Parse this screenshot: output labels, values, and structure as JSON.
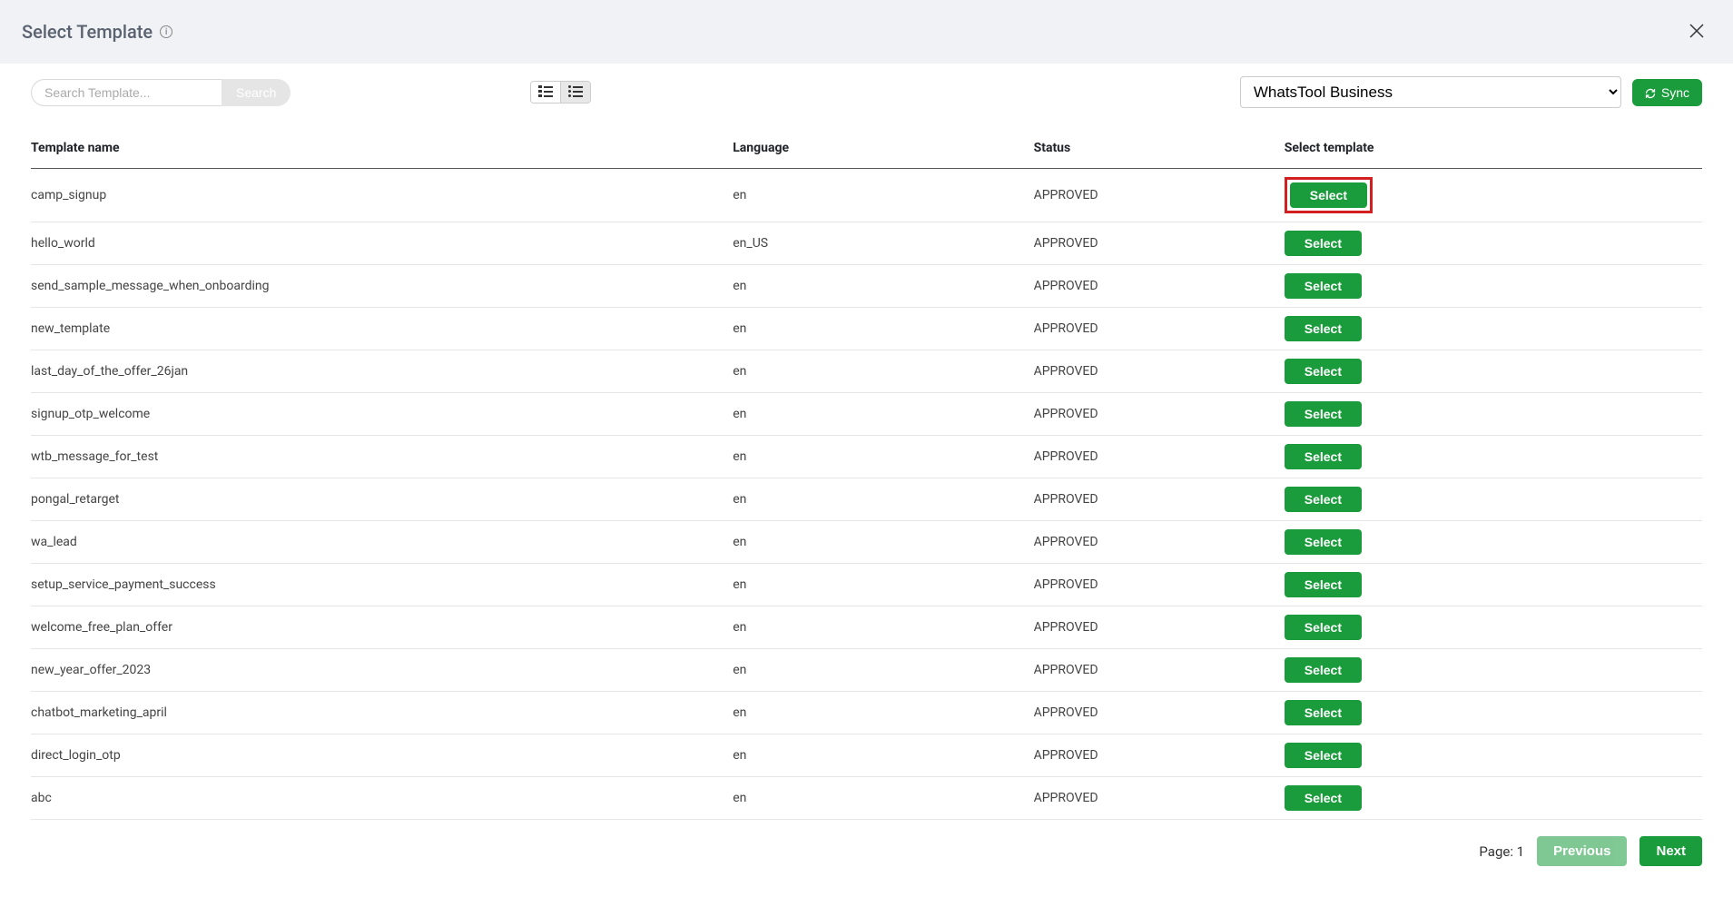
{
  "header": {
    "title": "Select Template"
  },
  "toolbar": {
    "search_placeholder": "Search Template...",
    "search_button": "Search",
    "account_selected": "WhatsTool Business",
    "sync_label": "Sync"
  },
  "table": {
    "columns": {
      "name": "Template name",
      "language": "Language",
      "status": "Status",
      "action": "Select template"
    },
    "select_label": "Select",
    "rows": [
      {
        "name": "camp_signup",
        "language": "en",
        "status": "APPROVED",
        "highlight": true
      },
      {
        "name": "hello_world",
        "language": "en_US",
        "status": "APPROVED",
        "highlight": false
      },
      {
        "name": "send_sample_message_when_onboarding",
        "language": "en",
        "status": "APPROVED",
        "highlight": false
      },
      {
        "name": "new_template",
        "language": "en",
        "status": "APPROVED",
        "highlight": false
      },
      {
        "name": "last_day_of_the_offer_26jan",
        "language": "en",
        "status": "APPROVED",
        "highlight": false
      },
      {
        "name": "signup_otp_welcome",
        "language": "en",
        "status": "APPROVED",
        "highlight": false
      },
      {
        "name": "wtb_message_for_test",
        "language": "en",
        "status": "APPROVED",
        "highlight": false
      },
      {
        "name": "pongal_retarget",
        "language": "en",
        "status": "APPROVED",
        "highlight": false
      },
      {
        "name": "wa_lead",
        "language": "en",
        "status": "APPROVED",
        "highlight": false
      },
      {
        "name": "setup_service_payment_success",
        "language": "en",
        "status": "APPROVED",
        "highlight": false
      },
      {
        "name": "welcome_free_plan_offer",
        "language": "en",
        "status": "APPROVED",
        "highlight": false
      },
      {
        "name": "new_year_offer_2023",
        "language": "en",
        "status": "APPROVED",
        "highlight": false
      },
      {
        "name": "chatbot_marketing_april",
        "language": "en",
        "status": "APPROVED",
        "highlight": false
      },
      {
        "name": "direct_login_otp",
        "language": "en",
        "status": "APPROVED",
        "highlight": false
      },
      {
        "name": "abc",
        "language": "en",
        "status": "APPROVED",
        "highlight": false
      }
    ]
  },
  "pagination": {
    "page_label": "Page: 1",
    "previous": "Previous",
    "next": "Next"
  }
}
